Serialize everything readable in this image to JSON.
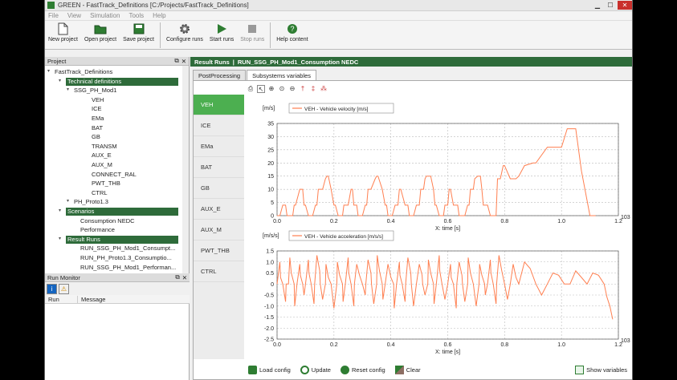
{
  "window": {
    "title": "GREEN - FastTrack_Definitions [C:/Projects/FastTrack_Definitions]"
  },
  "menu": [
    "File",
    "View",
    "Simulation",
    "Tools",
    "Help"
  ],
  "toolbar": {
    "new": "New project",
    "open": "Open project",
    "save": "Save project",
    "configure": "Configure runs",
    "start": "Start runs",
    "stop": "Stop runs",
    "help": "Help content"
  },
  "project": {
    "header": "Project",
    "root": "FastTrack_Definitions",
    "tech_defs": "Technical definitions",
    "model": "SSG_PH_Mod1",
    "components": [
      "VEH",
      "ICE",
      "EMa",
      "BAT",
      "GB",
      "TRANSM",
      "AUX_E",
      "AUX_M",
      "CONNECT_RAL",
      "PWT_THB",
      "CTRL"
    ],
    "proto": "PH_Proto1.3",
    "scenarios_label": "Scenarios",
    "scenarios": [
      "Consumption NEDC",
      "Performance"
    ],
    "results_label": "Result Runs",
    "runs": [
      "RUN_SSG_PH_Mod1_Consumpt...",
      "RUN_PH_Proto1.3_Consumptio...",
      "RUN_SSG_PH_Mod1_Performan..."
    ]
  },
  "run_monitor": {
    "header": "Run Monitor",
    "col_run": "Run",
    "col_message": "Message"
  },
  "result": {
    "label": "Result Runs",
    "run": "RUN_SSG_PH_Mod1_Consumption NEDC"
  },
  "tabs": [
    "PostProcessing",
    "Subsystems variables"
  ],
  "side_tabs": [
    "VEH",
    "ICE",
    "EMa",
    "BAT",
    "GB",
    "AUX_E",
    "AUX_M",
    "PWT_THB",
    "CTRL"
  ],
  "bottom": {
    "load": "Load config",
    "update": "Update",
    "reset": "Reset config",
    "clear": "Clear",
    "show": "Show variables"
  },
  "colors": {
    "series": "#ff7f50",
    "header_green": "#2e6b3a",
    "active_tab": "#4caf50"
  },
  "chart_data": [
    {
      "type": "line",
      "ylabel": "[m/s]",
      "series": [
        {
          "name": "VEH - Vehicle velocity [m/s]"
        }
      ],
      "xlabel": "X: time [s]",
      "x_multiplier": "10^3",
      "xlim": [
        0,
        1.2
      ],
      "ylim": [
        0,
        35
      ],
      "xticks": [
        "0.0",
        "0.2",
        "0.4",
        "0.6",
        "0.8",
        "1.0",
        "1.2"
      ],
      "yticks": [
        "0",
        "5",
        "10",
        "15",
        "20",
        "25",
        "30",
        "35"
      ],
      "x": [
        0,
        0.01,
        0.02,
        0.03,
        0.035,
        0.045,
        0.055,
        0.06,
        0.065,
        0.08,
        0.09,
        0.095,
        0.1,
        0.11,
        0.115,
        0.125,
        0.135,
        0.14,
        0.145,
        0.16,
        0.17,
        0.175,
        0.18,
        0.19,
        0.2,
        0.205,
        0.215,
        0.225,
        0.23,
        0.235,
        0.25,
        0.26,
        0.265,
        0.27,
        0.28,
        0.285,
        0.295,
        0.3,
        0.31,
        0.315,
        0.32,
        0.33,
        0.345,
        0.35,
        0.355,
        0.37,
        0.38,
        0.385,
        0.39,
        0.4,
        0.405,
        0.415,
        0.425,
        0.43,
        0.435,
        0.45,
        0.46,
        0.465,
        0.47,
        0.48,
        0.49,
        0.5,
        0.505,
        0.515,
        0.52,
        0.525,
        0.54,
        0.55,
        0.555,
        0.56,
        0.57,
        0.575,
        0.585,
        0.59,
        0.6,
        0.605,
        0.61,
        0.62,
        0.635,
        0.64,
        0.645,
        0.66,
        0.67,
        0.675,
        0.68,
        0.69,
        0.695,
        0.705,
        0.715,
        0.72,
        0.725,
        0.74,
        0.75,
        0.755,
        0.76,
        0.77,
        0.775,
        0.785,
        0.795,
        0.8,
        0.82,
        0.84,
        0.85,
        0.87,
        0.9,
        0.91,
        0.95,
        1.0,
        1.02,
        1.05,
        1.07,
        1.1,
        1.12,
        1.13,
        1.15,
        1.18
      ],
      "y": [
        0,
        0,
        4,
        4,
        0,
        0,
        0,
        4,
        4,
        10,
        10,
        4,
        4,
        0,
        0,
        0,
        4,
        4,
        10,
        10,
        14,
        15,
        15,
        10,
        4,
        4,
        0,
        0,
        0,
        4,
        4,
        10,
        10,
        4,
        4,
        0,
        0,
        0,
        4,
        4,
        10,
        10,
        14,
        15,
        15,
        10,
        4,
        4,
        0,
        0,
        0,
        4,
        4,
        10,
        10,
        4,
        4,
        0,
        0,
        0,
        4,
        4,
        10,
        10,
        14,
        15,
        15,
        10,
        4,
        4,
        0,
        0,
        0,
        4,
        4,
        10,
        10,
        4,
        4,
        0,
        0,
        0,
        4,
        4,
        10,
        10,
        14,
        15,
        15,
        10,
        4,
        4,
        0,
        0,
        0,
        0,
        14,
        14,
        19,
        19,
        14,
        14,
        15,
        19,
        20,
        20,
        26,
        26,
        33,
        33,
        17,
        0,
        0
      ]
    },
    {
      "type": "line",
      "ylabel": "[m/s/s]",
      "series": [
        {
          "name": "VEH - Vehicle acceleration [m/s/s]"
        }
      ],
      "xlabel": "X: time [s]",
      "x_multiplier": "10^3",
      "xlim": [
        0,
        1.2
      ],
      "ylim": [
        -2.5,
        1.5
      ],
      "xticks": [
        "0.0",
        "0.2",
        "0.4",
        "0.6",
        "0.8",
        "1.0",
        "1.2"
      ],
      "yticks": [
        "1.5",
        "1.0",
        "0.5",
        "0",
        "-0.5",
        "-1.0",
        "-1.5",
        "-2.0",
        "-2.5"
      ],
      "x": [
        0,
        0.01,
        0.012,
        0.02,
        0.03,
        0.032,
        0.04,
        0.045,
        0.05,
        0.06,
        0.062,
        0.07,
        0.08,
        0.082,
        0.09,
        0.095,
        0.1,
        0.11,
        0.112,
        0.12,
        0.13,
        0.132,
        0.14,
        0.15,
        0.152,
        0.16,
        0.17,
        0.172,
        0.18,
        0.19,
        0.2,
        0.21,
        0.212,
        0.22,
        0.23,
        0.232,
        0.24,
        0.25,
        0.252,
        0.26,
        0.27,
        0.272,
        0.28,
        0.29,
        0.3,
        0.31,
        0.312,
        0.32,
        0.33,
        0.332,
        0.34,
        0.35,
        0.352,
        0.36,
        0.37,
        0.372,
        0.38,
        0.39,
        0.4,
        0.41,
        0.412,
        0.42,
        0.43,
        0.432,
        0.44,
        0.45,
        0.452,
        0.46,
        0.47,
        0.472,
        0.48,
        0.49,
        0.5,
        0.51,
        0.512,
        0.52,
        0.53,
        0.532,
        0.54,
        0.55,
        0.552,
        0.56,
        0.57,
        0.572,
        0.58,
        0.59,
        0.6,
        0.61,
        0.612,
        0.62,
        0.63,
        0.632,
        0.64,
        0.65,
        0.652,
        0.66,
        0.67,
        0.672,
        0.68,
        0.69,
        0.7,
        0.71,
        0.712,
        0.72,
        0.73,
        0.732,
        0.74,
        0.75,
        0.752,
        0.76,
        0.77,
        0.772,
        0.78,
        0.79,
        0.8,
        0.81,
        0.82,
        0.83,
        0.84,
        0.85,
        0.87,
        0.89,
        0.91,
        0.93,
        0.95,
        0.97,
        0.99,
        1.01,
        1.03,
        1.05,
        1.07,
        1.09,
        1.11,
        1.13,
        1.14,
        1.15,
        1.16,
        1.17,
        1.18
      ],
      "y": [
        0,
        1.0,
        0.3,
        0,
        -0.8,
        0,
        0,
        1.2,
        0.5,
        0,
        -1.0,
        0,
        0.9,
        0.4,
        0,
        -0.5,
        0,
        1.1,
        0.5,
        0,
        -0.9,
        0,
        1.3,
        0.6,
        0,
        -0.7,
        0,
        0.9,
        0.3,
        0,
        -1.1,
        0,
        1.0,
        0.4,
        0,
        -0.8,
        0,
        1.2,
        0.5,
        0,
        -1.0,
        0,
        0.9,
        0.4,
        0,
        -0.5,
        0,
        1.1,
        0.5,
        0,
        -0.9,
        0,
        1.3,
        0.6,
        0,
        -0.7,
        0,
        0.9,
        0.3,
        0,
        -1.1,
        0,
        1.0,
        0.4,
        0,
        -0.8,
        0,
        1.2,
        0.5,
        0,
        -1.0,
        0,
        0.9,
        0.4,
        0,
        -0.5,
        0,
        1.1,
        0.5,
        0,
        -0.9,
        0,
        1.3,
        0.6,
        0,
        -0.7,
        0,
        0.9,
        0.3,
        0,
        -1.1,
        0,
        1.0,
        0.4,
        0,
        -0.8,
        0,
        1.2,
        0.5,
        0,
        -1.0,
        0,
        0.9,
        0.4,
        0,
        -0.5,
        0,
        1.1,
        0.5,
        0,
        -0.9,
        0,
        1.3,
        0.6,
        0,
        -0.7,
        0,
        0.9,
        0.3,
        0,
        1.0,
        0.7,
        0,
        -0.5,
        0,
        0.5,
        0.4,
        0,
        0,
        0.6,
        0.3,
        0,
        0.5,
        0.4,
        0.2,
        0,
        -0.6,
        -1.0,
        -1.6,
        -2.0,
        -2.2,
        -0.5,
        1.3
      ]
    }
  ]
}
